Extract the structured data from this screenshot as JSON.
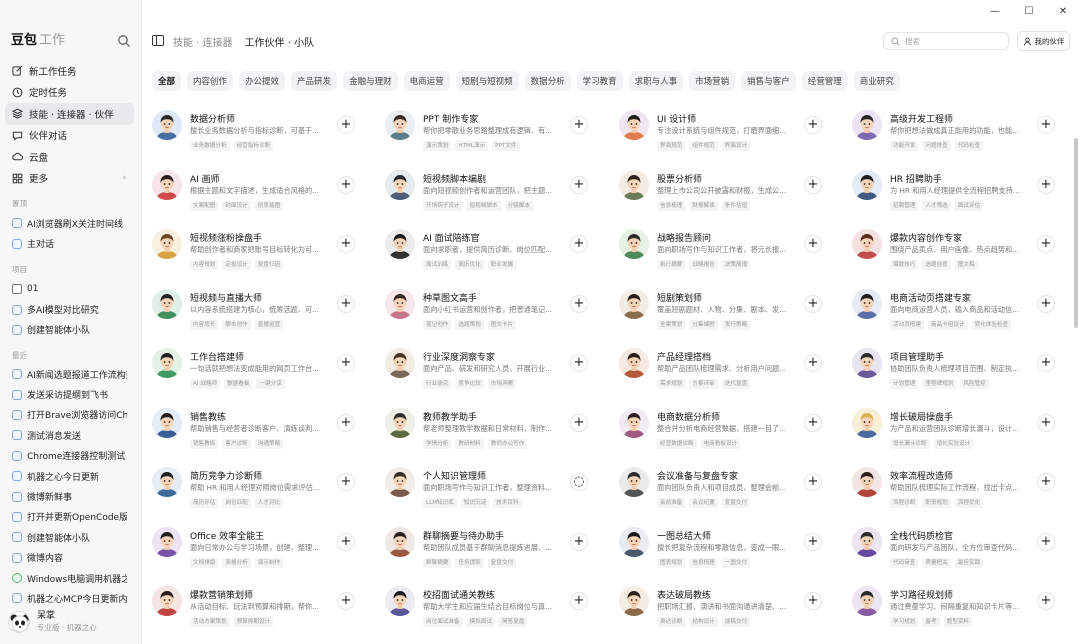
{
  "window_controls": [
    "—",
    "☐",
    "✕"
  ],
  "brand": {
    "name": "豆包",
    "sub": "工作"
  },
  "nav": [
    {
      "label": "新工作任务",
      "icon": "edit-icon"
    },
    {
      "label": "定时任务",
      "icon": "clock-icon"
    },
    {
      "label": "技能 · 连接器 · 伙伴",
      "icon": "layers-icon",
      "active": true
    },
    {
      "label": "伙伴对话",
      "icon": "chat-icon"
    },
    {
      "label": "云盘",
      "icon": "cloud-icon"
    },
    {
      "label": "更多",
      "icon": "grid-icon",
      "chevron": "›"
    }
  ],
  "section_pinned": "置顶",
  "pinned": [
    {
      "label": "AI浏览器刷X关注时间线"
    },
    {
      "label": "主对话"
    }
  ],
  "section_projects": "项目",
  "projects": [
    {
      "label": "01",
      "type": "folder"
    },
    {
      "label": "多AI模型对比研究"
    },
    {
      "label": "创建智能体小队"
    }
  ],
  "section_recent": "最近",
  "recent": [
    {
      "label": "AI新闻选题报道工作流构建"
    },
    {
      "label": "发送采访提纲到飞书"
    },
    {
      "label": "打开Brave浏览器访问Chrome"
    },
    {
      "label": "测试消息发送"
    },
    {
      "label": "Chrome连接器控制测试"
    },
    {
      "label": "机器之心今日更新"
    },
    {
      "label": "微博新鲜事"
    },
    {
      "label": "打开并更新OpenCode版本"
    },
    {
      "label": "创建智能体小队"
    },
    {
      "label": "微博内容"
    },
    {
      "label": "Windows电脑调用机器之心",
      "type": "green"
    },
    {
      "label": "机器之心MCP今日更新内容"
    }
  ],
  "user": {
    "name": "呆掌",
    "sub": "专业版 · 机器之心"
  },
  "breadcrumb": {
    "parent": "技能 · 连接器",
    "current": "工作伙伴 · 小队"
  },
  "search_placeholder": "搜索",
  "my_partner_label": "我的伙伴",
  "categories": [
    "全部",
    "内容创作",
    "办公提效",
    "产品研发",
    "金融与理财",
    "电商运营",
    "短剧与短视频",
    "数据分析",
    "学习教育",
    "求职与人事",
    "市场营销",
    "销售与客户",
    "经营管理",
    "商业研究"
  ],
  "cards": [
    {
      "title": "数据分析师",
      "desc": "擅长业务数据分析与指标诊断，可基于...",
      "tags": [
        "业务数据分析",
        "经营指标诊断"
      ],
      "bg": "#dfe9f7",
      "hair": "#2b2b2b",
      "shirt": "#4a6fa5",
      "action": "+"
    },
    {
      "title": "PPT 制作专家",
      "desc": "帮你把零散业务思路整理成有逻辑、有...",
      "tags": [
        "演示策划",
        "HTML演示",
        "PPT文件"
      ],
      "bg": "#e8eef0",
      "hair": "#3a2a1f",
      "shirt": "#5d7e8c",
      "action": "+"
    },
    {
      "title": "UI 设计师",
      "desc": "专注设计系统与组件规范，打磨界面细...",
      "tags": [
        "界面规范",
        "组件规范",
        "界面设计"
      ],
      "bg": "#f0e6f2",
      "hair": "#1d1d1d",
      "shirt": "#e07a4f",
      "action": "+"
    },
    {
      "title": "高级开发工程师",
      "desc": "帮你把想法做成真正能用的功能，也能...",
      "tags": [
        "功能开发",
        "问题排查",
        "代码检查"
      ],
      "bg": "#ece4f4",
      "hair": "#2a2a2a",
      "shirt": "#7d6ab0",
      "action": "+"
    },
    {
      "title": "AI 画师",
      "desc": "根据主题和文字描述，生成适合风格的...",
      "tags": [
        "文案配图",
        "封面设计",
        "创意插图"
      ],
      "bg": "#f6e4e8",
      "hair": "#2b1d1d",
      "shirt": "#d34a4a",
      "action": "+"
    },
    {
      "title": "短视频脚本编剧",
      "desc": "面向短视频创作者和运营团队，把主题...",
      "tags": [
        "开场钩子设计",
        "短视频脚本",
        "分镜脚本"
      ],
      "bg": "#e6ecf2",
      "hair": "#2a2a2a",
      "shirt": "#4c5e78",
      "action": "+"
    },
    {
      "title": "股票分析师",
      "desc": "整理上市公司公开披露和财报，生成公...",
      "tags": [
        "信息梳理",
        "财报解读",
        "条件估值"
      ],
      "bg": "#f4ece2",
      "hair": "#2e2218",
      "shirt": "#6b7c59",
      "action": "+"
    },
    {
      "title": "HR 招聘助手",
      "desc": "为 HR 和用人经理提供全流程招聘支持...",
      "tags": [
        "招聘管理",
        "人才筛选",
        "面试评估"
      ],
      "bg": "#e5ebf5",
      "hair": "#1e1e1e",
      "shirt": "#3d5a80",
      "action": "+"
    },
    {
      "title": "短视频涨粉操盘手",
      "desc": "帮助创作者和商家把账号目标转化为可...",
      "tags": [
        "内容规划",
        "定投设计",
        "复盘归因"
      ],
      "bg": "#f7efe0",
      "hair": "#6b4423",
      "shirt": "#d9a441",
      "action": "+"
    },
    {
      "title": "AI 面试陪练官",
      "desc": "面向求职者，提供简历诊断、岗位匹配...",
      "tags": [
        "面试训练",
        "简历优化",
        "职业发展"
      ],
      "bg": "#ececec",
      "hair": "#1a1a1a",
      "shirt": "#333333",
      "action": "+"
    },
    {
      "title": "战略报告顾问",
      "desc": "面向职场写作与知识工作者，将元长报...",
      "tags": [
        "执行摘要",
        "战略报告",
        "决策简报"
      ],
      "bg": "#e6f0e4",
      "hair": "#2b2b2b",
      "shirt": "#4f8a5b",
      "action": "+"
    },
    {
      "title": "爆款内容创作专家",
      "desc": "围绕产品卖点、用户画像、热点趋势和...",
      "tags": [
        "爆款技巧",
        "选题创意",
        "图文稿"
      ],
      "bg": "#f4e2e2",
      "hair": "#5a2d1c",
      "shirt": "#c0504d",
      "action": "+"
    },
    {
      "title": "短视频与直播大师",
      "desc": "以内容系统搭建为核心，统筹选题、可...",
      "tags": [
        "内容增长",
        "脚本创作",
        "直播运营"
      ],
      "bg": "#e2efe6",
      "hair": "#222222",
      "shirt": "#3f8f5f",
      "action": "+"
    },
    {
      "title": "种草图文高手",
      "desc": "面向小红书运营和创作者，把普通笔记...",
      "tags": [
        "笔记创作",
        "选题策划",
        "图文卡片"
      ],
      "bg": "#f5e6ea",
      "hair": "#3b2a22",
      "shirt": "#c8778a",
      "action": "+"
    },
    {
      "title": "短剧策划师",
      "desc": "覆盖短剧题材、人物、分集、剧本、发...",
      "tags": [
        "全案策划",
        "分集编剧",
        "发行策略"
      ],
      "bg": "#f1ece4",
      "hair": "#2b1f19",
      "shirt": "#8a6d4f",
      "action": "+"
    },
    {
      "title": "电商活动页搭建专家",
      "desc": "面向电商运营人员，输入商品和活动信...",
      "tags": [
        "活动页搭建",
        "商品卡组设计",
        "转化体验检查"
      ],
      "bg": "#e6eaf4",
      "hair": "#1f1f1f",
      "shirt": "#5a6ea8",
      "action": "+"
    },
    {
      "title": "工作台搭建师",
      "desc": "一句话就把想法变成能用的网页工作台...",
      "tags": [
        "AI 战略师",
        "数据看板",
        "一键分享"
      ],
      "bg": "#e4f1e6",
      "hair": "#1d1d1d",
      "shirt": "#3f9a63",
      "action": "+"
    },
    {
      "title": "行业深度洞察专家",
      "desc": "面向产品、研发和研究人员，开展行业...",
      "tags": [
        "行业研究",
        "竞争比较",
        "市场洞察"
      ],
      "bg": "#f2ebe2",
      "hair": "#4a2f1f",
      "shirt": "#7a6a5a",
      "action": "+"
    },
    {
      "title": "产品经理搭档",
      "desc": "帮助产品团队梳理需求、分析用户问题...",
      "tags": [
        "需求规划",
        "方案评审",
        "迭代复盘"
      ],
      "bg": "#f5e9e2",
      "hair": "#2a1d15",
      "shirt": "#b55a3a",
      "action": "+"
    },
    {
      "title": "项目管理助手",
      "desc": "协助团队负责人梳理项目范围、制定执...",
      "tags": [
        "计划管理",
        "里程碑规划",
        "风险管控"
      ],
      "bg": "#e8e4f0",
      "hair": "#2a2a2a",
      "shirt": "#6a5a9a",
      "action": "+"
    },
    {
      "title": "销售教练",
      "desc": "帮助销售与经营者诊断客户、演练谈判...",
      "tags": [
        "销售教练",
        "客户诊断",
        "沟通策略"
      ],
      "bg": "#e4ecf6",
      "hair": "#1f1f1f",
      "shirt": "#3a5f9a",
      "action": "+"
    },
    {
      "title": "教师教学助手",
      "desc": "帮老师整理教学数据和日常材料，制作...",
      "tags": [
        "学情分析",
        "教研材料",
        "教师办公写作"
      ],
      "bg": "#eef0e8",
      "hair": "#2b2b2b",
      "shirt": "#5b6b3f",
      "action": "+"
    },
    {
      "title": "电商数据分析师",
      "desc": "整合并分析电商经营数据，搭建一目了...",
      "tags": [
        "经营数据诊断",
        "电商看板设计"
      ],
      "bg": "#f1eaf2",
      "hair": "#2e1e22",
      "shirt": "#a05a80",
      "action": "+"
    },
    {
      "title": "增长破局操盘手",
      "desc": "为产品和运营团队诊断增长漏斗，设计...",
      "tags": [
        "增长漏斗诊断",
        "增长实验设计"
      ],
      "bg": "#f8efd8",
      "hair": "#d9b25a",
      "shirt": "#4a6aa0",
      "action": "+"
    },
    {
      "title": "简历竞争力诊断师",
      "desc": "帮助 HR 和用人经理对照岗位需求评估...",
      "tags": [
        "简历评估",
        "岗位匹配",
        "人才对比"
      ],
      "bg": "#e6edf5",
      "hair": "#1f1f1f",
      "shirt": "#3d6a9a",
      "action": "+"
    },
    {
      "title": "个人知识管理师",
      "desc": "面向职场写作与知识工作者，整理资料...",
      "tags": [
        "LLM知识库",
        "知识沉淀",
        "技术百科"
      ],
      "bg": "#f1ece8",
      "hair": "#3a2a22",
      "shirt": "#7a5a4a",
      "action": "◌"
    },
    {
      "title": "会议准备与复盘专家",
      "desc": "面向团队负责人和项目成员，整理会前...",
      "tags": [
        "会前准备",
        "会议纪要",
        "复盘交付"
      ],
      "bg": "#eaeaea",
      "hair": "#2a2a2a",
      "shirt": "#555555",
      "action": "+"
    },
    {
      "title": "效率流程改造师",
      "desc": "帮助团队梳理实际工作流程，找出卡点...",
      "tags": [
        "流程诊断",
        "职责规划",
        "流程优化"
      ],
      "bg": "#f2e6e4",
      "hair": "#2b1b1b",
      "shirt": "#b0453e",
      "action": "+"
    },
    {
      "title": "Office 效率全能王",
      "desc": "面向日常办公与学习场景，创建、整理...",
      "tags": [
        "文档排版",
        "表格分析",
        "演示制作"
      ],
      "bg": "#ece4f2",
      "hair": "#1e1e1e",
      "shirt": "#7a52a8",
      "action": "+"
    },
    {
      "title": "群聊摘要与待办助手",
      "desc": "帮助团队成员基于群聊消息提炼进展、...",
      "tags": [
        "群聊摘要",
        "任务提取",
        "复盘交付"
      ],
      "bg": "#f0e8e4",
      "hair": "#2a1e1a",
      "shirt": "#9a5a3f",
      "action": "+"
    },
    {
      "title": "一图总结大师",
      "desc": "擅长把复杂流程和零散信息，变成一眼...",
      "tags": [
        "图表规划",
        "信息梳理",
        "一图交付"
      ],
      "bg": "#e8ecf0",
      "hair": "#1a1a1a",
      "shirt": "#4a5a6a",
      "action": "+"
    },
    {
      "title": "全栈代码质检官",
      "desc": "面向研发与产品团队，全方位审查代码...",
      "tags": [
        "代码审查",
        "质量把关",
        "最佳实践"
      ],
      "bg": "#ebe6f2",
      "hair": "#2a2a2a",
      "shirt": "#6a4aa0",
      "action": "+"
    },
    {
      "title": "爆款营销策划师",
      "desc": "从活动目标、玩法到预算和排期，帮你...",
      "tags": [
        "活动方案策划",
        "预算排期设计"
      ],
      "bg": "#f5e4e4",
      "hair": "#2a1a1a",
      "shirt": "#c04545",
      "action": "+"
    },
    {
      "title": "校招面试通关教练",
      "desc": "帮助大学生和应届生结合目标岗位与真...",
      "tags": [
        "岗位面试准备",
        "模拟面试",
        "简答复盘"
      ],
      "bg": "#ecebf4",
      "hair": "#1f1f1f",
      "shirt": "#5a5a9a",
      "action": "+"
    },
    {
      "title": "表达破局教练",
      "desc": "把职场汇报、演讲和书面沟通讲清楚、...",
      "tags": [
        "表达诊断",
        "结构设计",
        "成稿交付"
      ],
      "bg": "#f4ede4",
      "hair": "#2b1f17",
      "shirt": "#8a6a4a",
      "action": "+"
    },
    {
      "title": "学习路径规划师",
      "desc": "通过费曼学习、间隔重复和知识卡片等...",
      "tags": [
        "学习规划",
        "备考",
        "题型资料"
      ],
      "bg": "#ede6f2",
      "hair": "#2a2a2a",
      "shirt": "#8a5aa0",
      "action": "+"
    }
  ]
}
